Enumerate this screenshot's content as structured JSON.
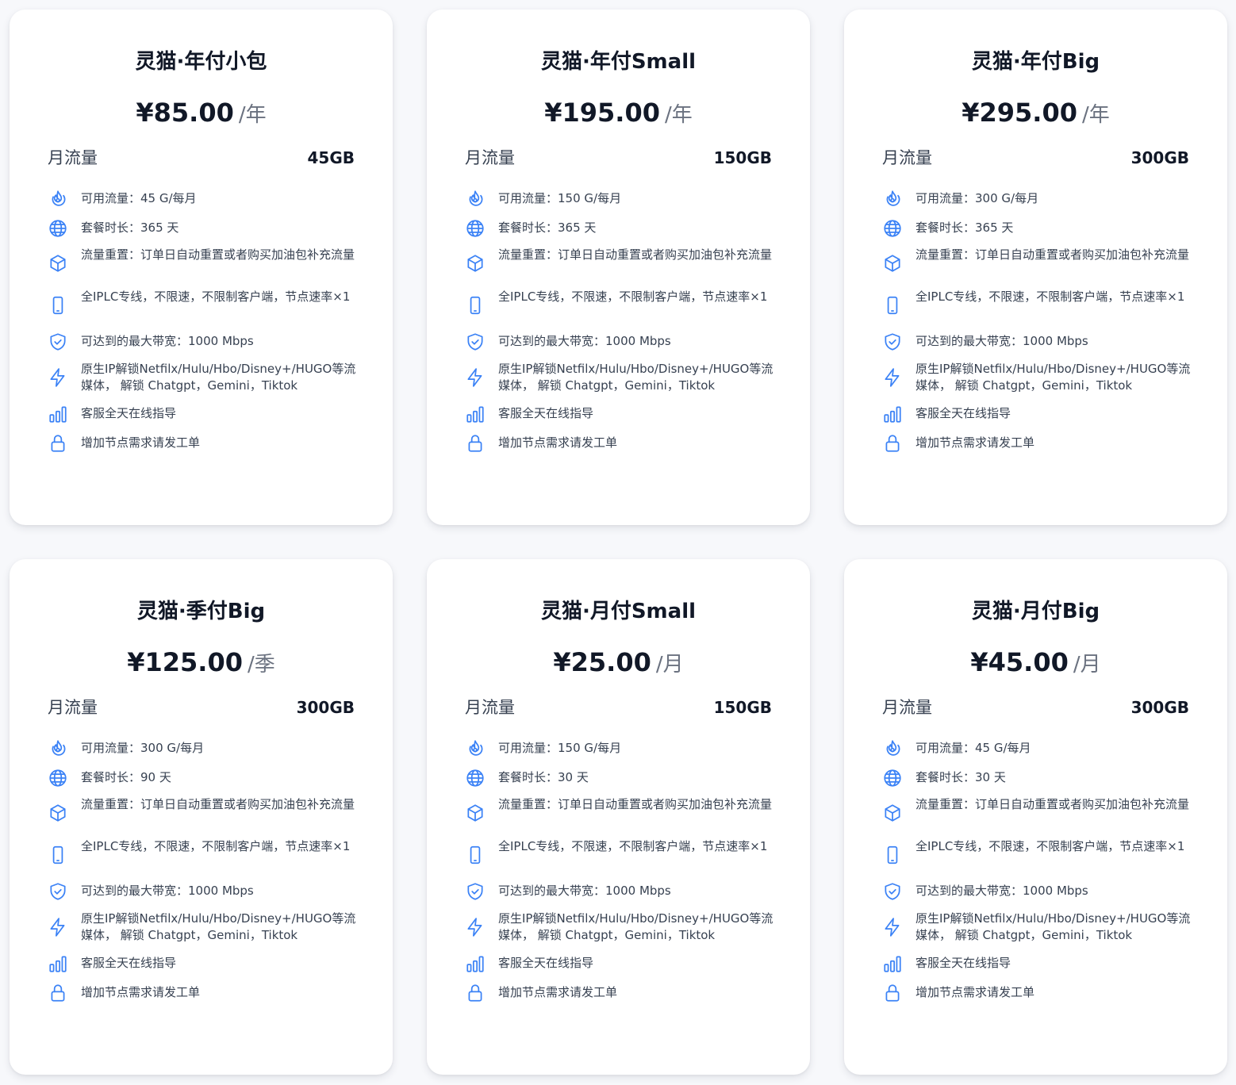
{
  "traffic_label": "月流量",
  "plans": [
    {
      "title": "灵猫·年付小包",
      "price": "¥85.00",
      "period": "/年",
      "traffic": "45GB",
      "features": [
        "可用流量：45 G/每月",
        "套餐时长：365 天",
        "流量重置：订单日自动重置或者购买加油包补充流量",
        "全IPLC专线，不限速，不限制客户端，节点速率×1",
        "可达到的最大带宽：1000 Mbps",
        "原生IP解锁Netfilx/Hulu/Hbo/Disney+/HUGO等流媒体， 解锁 Chatgpt，Gemini，Tiktok",
        "客服全天在线指导",
        "增加节点需求请发工单"
      ]
    },
    {
      "title": "灵猫·年付Small",
      "price": "¥195.00",
      "period": "/年",
      "traffic": "150GB",
      "features": [
        "可用流量：150 G/每月",
        "套餐时长：365 天",
        "流量重置：订单日自动重置或者购买加油包补充流量",
        "全IPLC专线，不限速，不限制客户端，节点速率×1",
        "可达到的最大带宽：1000 Mbps",
        "原生IP解锁Netfilx/Hulu/Hbo/Disney+/HUGO等流媒体， 解锁 Chatgpt，Gemini，Tiktok",
        "客服全天在线指导",
        "增加节点需求请发工单"
      ]
    },
    {
      "title": "灵猫·年付Big",
      "price": "¥295.00",
      "period": "/年",
      "traffic": "300GB",
      "features": [
        "可用流量：300 G/每月",
        "套餐时长：365 天",
        "流量重置：订单日自动重置或者购买加油包补充流量",
        "全IPLC专线，不限速，不限制客户端，节点速率×1",
        "可达到的最大带宽：1000 Mbps",
        "原生IP解锁Netfilx/Hulu/Hbo/Disney+/HUGO等流媒体， 解锁 Chatgpt，Gemini，Tiktok",
        "客服全天在线指导",
        "增加节点需求请发工单"
      ]
    },
    {
      "title": "灵猫·季付Big",
      "price": "¥125.00",
      "period": "/季",
      "traffic": "300GB",
      "features": [
        "可用流量：300 G/每月",
        "套餐时长：90 天",
        "流量重置：订单日自动重置或者购买加油包补充流量",
        "全IPLC专线，不限速，不限制客户端，节点速率×1",
        "可达到的最大带宽：1000 Mbps",
        "原生IP解锁Netfilx/Hulu/Hbo/Disney+/HUGO等流媒体， 解锁 Chatgpt，Gemini，Tiktok",
        "客服全天在线指导",
        "增加节点需求请发工单"
      ]
    },
    {
      "title": "灵猫·月付Small",
      "price": "¥25.00",
      "period": "/月",
      "traffic": "150GB",
      "features": [
        "可用流量：150 G/每月",
        "套餐时长：30 天",
        "流量重置：订单日自动重置或者购买加油包补充流量",
        "全IPLC专线，不限速，不限制客户端，节点速率×1",
        "可达到的最大带宽：1000 Mbps",
        "原生IP解锁Netfilx/Hulu/Hbo/Disney+/HUGO等流媒体， 解锁 Chatgpt，Gemini，Tiktok",
        "客服全天在线指导",
        "增加节点需求请发工单"
      ]
    },
    {
      "title": "灵猫·月付Big",
      "price": "¥45.00",
      "period": "/月",
      "traffic": "300GB",
      "features": [
        "可用流量：45 G/每月",
        "套餐时长：30 天",
        "流量重置：订单日自动重置或者购买加油包补充流量",
        "全IPLC专线，不限速，不限制客户端，节点速率×1",
        "可达到的最大带宽：1000 Mbps",
        "原生IP解锁Netfilx/Hulu/Hbo/Disney+/HUGO等流媒体， 解锁 Chatgpt，Gemini，Tiktok",
        "客服全天在线指导",
        "增加节点需求请发工单"
      ]
    }
  ],
  "feature_icons": [
    "flame-icon",
    "globe-icon",
    "cube-icon",
    "phone-icon",
    "shield-check-icon",
    "lightning-icon",
    "bar-chart-icon",
    "lock-icon"
  ],
  "colors": {
    "icon": "#3b82f6",
    "title": "#111827",
    "period": "#6b7280",
    "card_bg": "#ffffff",
    "page_bg": "#f7f8fb"
  }
}
